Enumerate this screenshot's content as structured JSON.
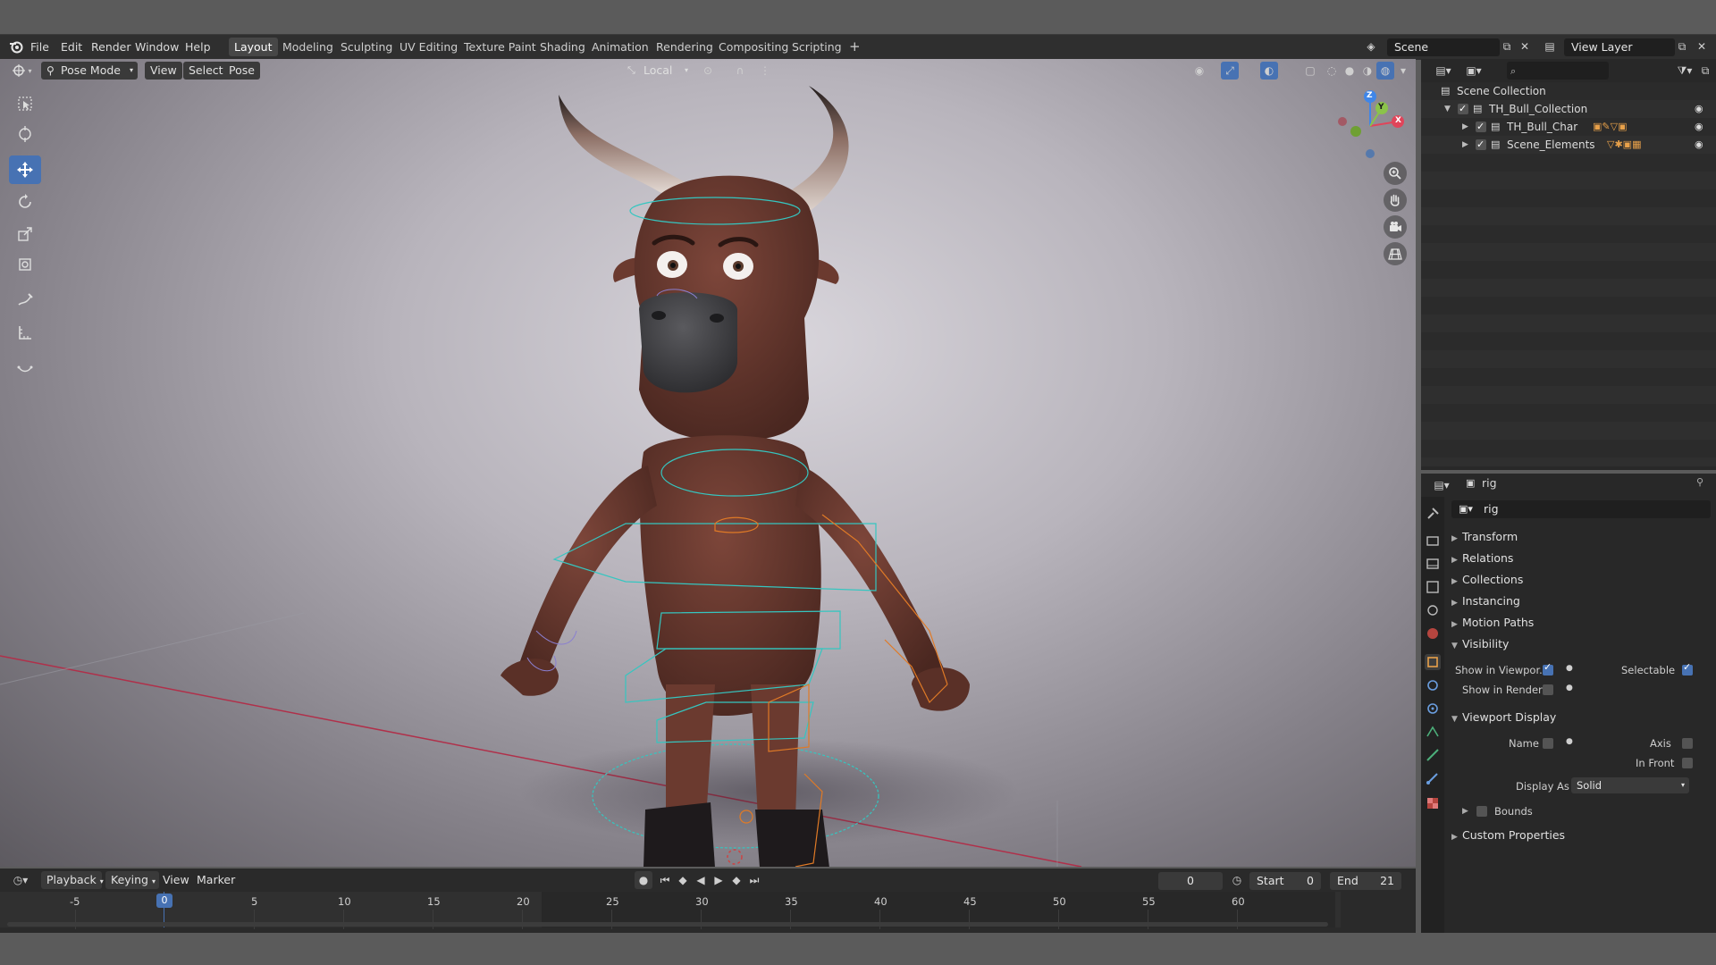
{
  "topbar": {
    "menus": [
      "File",
      "Edit",
      "Render",
      "Window",
      "Help"
    ],
    "workspaces": [
      "Layout",
      "Modeling",
      "Sculpting",
      "UV Editing",
      "Texture Paint",
      "Shading",
      "Animation",
      "Rendering",
      "Compositing",
      "Scripting"
    ],
    "active_workspace": "Layout",
    "add_tab": "+",
    "scene_name": "Scene",
    "view_layer": "View Layer"
  },
  "viewport": {
    "mode": "Pose Mode",
    "menus": [
      "View",
      "Select",
      "Pose"
    ],
    "orientation": "Local",
    "gizmo_axes": [
      "X",
      "Y",
      "Z"
    ]
  },
  "outliner": {
    "root": "Scene Collection",
    "items": [
      {
        "label": "TH_Bull_Collection",
        "level": 1
      },
      {
        "label": "TH_Bull_Char",
        "level": 2
      },
      {
        "label": "Scene_Elements",
        "level": 2
      }
    ]
  },
  "properties": {
    "object_name": "rig",
    "name_field": "rig",
    "sections": {
      "transform": "Transform",
      "relations": "Relations",
      "collections": "Collections",
      "instancing": "Instancing",
      "motion_paths": "Motion Paths",
      "visibility": "Visibility",
      "viewport_display": "Viewport Display",
      "custom_properties": "Custom Properties"
    },
    "visibility": {
      "show_in_viewport": "Show in Viewpor..",
      "selectable": "Selectable",
      "show_in_renders": "Show in Renders"
    },
    "viewport_display": {
      "name": "Name",
      "axis": "Axis",
      "in_front": "In Front",
      "display_as": "Display As",
      "display_as_value": "Solid",
      "bounds": "Bounds"
    }
  },
  "timeline": {
    "menus": [
      "Playback",
      "Keying",
      "View",
      "Marker"
    ],
    "current_frame": "0",
    "start_label": "Start",
    "start_value": "0",
    "end_label": "End",
    "end_value": "21",
    "playhead_label": "0",
    "ticks": [
      "-5",
      "5",
      "10",
      "15",
      "20",
      "25",
      "30",
      "35",
      "40",
      "45",
      "50",
      "55",
      "60"
    ]
  },
  "colors": {
    "accent": "#4772b3",
    "axis_x": "#e0455a",
    "axis_y": "#8bc34a",
    "axis_z": "#3f86e8",
    "bull_body": "#6b3a2f",
    "rig_cyan": "#35c6c0",
    "rig_orange": "#e07a26"
  }
}
